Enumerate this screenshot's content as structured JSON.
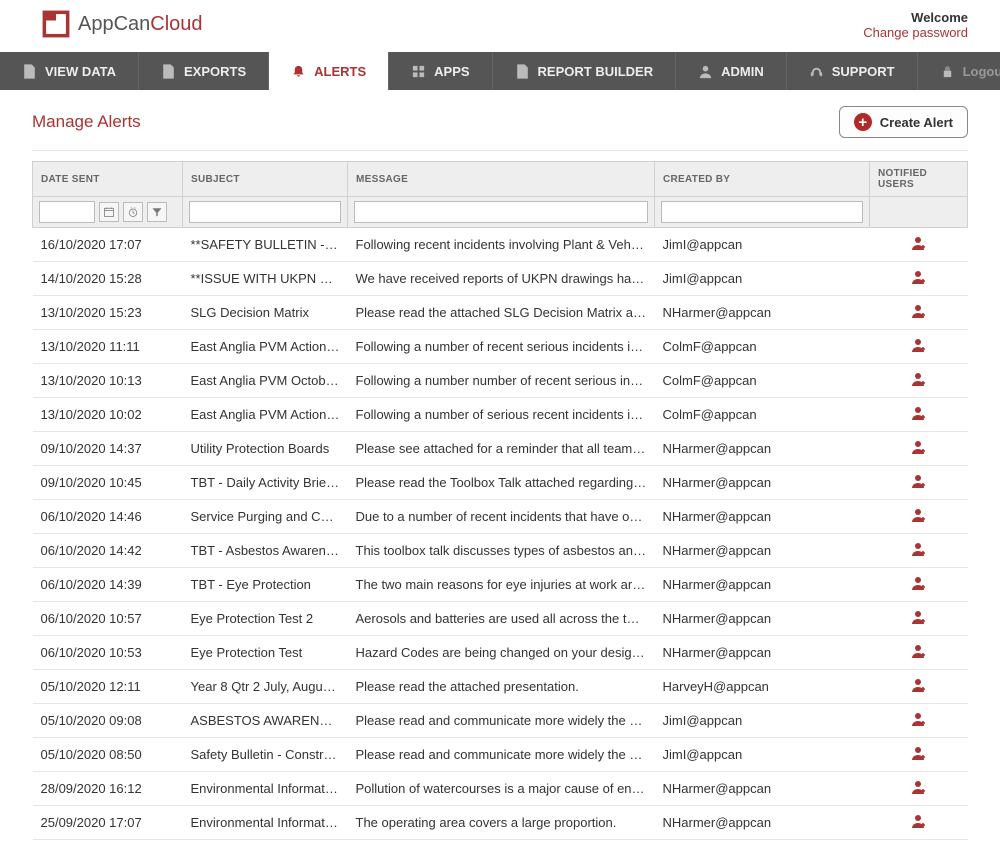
{
  "brand": {
    "name1": "AppCan",
    "name2": "Cloud"
  },
  "header": {
    "welcome": "Welcome",
    "change_password": "Change password"
  },
  "nav": {
    "view_data": "VIEW DATA",
    "exports": "EXPORTS",
    "alerts": "ALERTS",
    "apps": "APPS",
    "report_builder": "REPORT BUILDER",
    "admin": "ADMIN",
    "support": "SUPPORT",
    "logout": "Logout"
  },
  "page": {
    "title": "Manage Alerts",
    "create_button": "Create Alert"
  },
  "columns": {
    "date_sent": "DATE SENT",
    "subject": "SUBJECT",
    "message": "MESSAGE",
    "created_by": "CREATED BY",
    "notified_users": "NOTIFIED USERS"
  },
  "rows": [
    {
      "date": "16/10/2020 17:07",
      "subject": "**SAFETY BULLETIN - P…",
      "message": "Following recent incidents involving Plant & Vehicle…",
      "created_by": "JimI@appcan"
    },
    {
      "date": "14/10/2020 15:28",
      "subject": "**ISSUE WITH UKPN EL…",
      "message": "We have received reports of UKPN drawings havin…",
      "created_by": "JimI@appcan"
    },
    {
      "date": "13/10/2020 15:23",
      "subject": "SLG Decision Matrix",
      "message": "Please read the attached SLG Decision Matrix and …",
      "created_by": "NHarmer@appcan"
    },
    {
      "date": "13/10/2020 11:11",
      "subject": "East Anglia PVM Action Plan",
      "message": "Following a number of recent serious incidents invo…",
      "created_by": "ColmF@appcan"
    },
    {
      "date": "13/10/2020 10:13",
      "subject": "East Anglia PVM October …",
      "message": "Following a number number of recent serious incid…",
      "created_by": "ColmF@appcan"
    },
    {
      "date": "13/10/2020 10:02",
      "subject": "East Anglia PVM Action Pl…",
      "message": "Following a number of serious recent incidents invo…",
      "created_by": "ColmF@appcan"
    },
    {
      "date": "09/10/2020 14:37",
      "subject": "Utility Protection Boards",
      "message": "Please see attached for a reminder that all teams s…",
      "created_by": "NHarmer@appcan"
    },
    {
      "date": "09/10/2020 10:45",
      "subject": "TBT - Daily Activity Briefing",
      "message": "Please read the Toolbox Talk attached regarding D…",
      "created_by": "NHarmer@appcan"
    },
    {
      "date": "06/10/2020 14:46",
      "subject": "Service Purging and Com…",
      "message": "Due to a number of recent incidents that have occu…",
      "created_by": "NHarmer@appcan"
    },
    {
      "date": "06/10/2020 14:42",
      "subject": "TBT - Asbestos Awareness",
      "message": "This toolbox talk discusses types of asbestos and a…",
      "created_by": "NHarmer@appcan"
    },
    {
      "date": "06/10/2020 14:39",
      "subject": "TBT - Eye Protection",
      "message": "The two main reasons for eye injuries at work are n…",
      "created_by": "NHarmer@appcan"
    },
    {
      "date": "06/10/2020 10:57",
      "subject": "Eye Protection Test 2",
      "message": "Aerosols and batteries are used all across the tRII…",
      "created_by": "NHarmer@appcan"
    },
    {
      "date": "06/10/2020 10:53",
      "subject": "Eye Protection Test",
      "message": "Hazard Codes are being changed on your design d…",
      "created_by": "NHarmer@appcan"
    },
    {
      "date": "05/10/2020 12:11",
      "subject": "Year 8 Qtr 2 July, August, …",
      "message": "Please read the attached presentation.",
      "created_by": "HarveyH@appcan"
    },
    {
      "date": "05/10/2020 09:08",
      "subject": "ASBESTOS AWARENES…",
      "message": "Please read and communicate more widely the atta…",
      "created_by": "JimI@appcan"
    },
    {
      "date": "05/10/2020 08:50",
      "subject": "Safety Bulletin - Construct…",
      "message": "Please read and communicate more widely the atta…",
      "created_by": "JimI@appcan"
    },
    {
      "date": "28/09/2020 16:12",
      "subject": "Environmental Information…",
      "message": "Pollution of watercourses is a major cause of envir…",
      "created_by": "NHarmer@appcan"
    },
    {
      "date": "25/09/2020 17:07",
      "subject": "Environmental Information…",
      "message": "The operating area covers a large proportion.",
      "created_by": "NHarmer@appcan"
    }
  ]
}
